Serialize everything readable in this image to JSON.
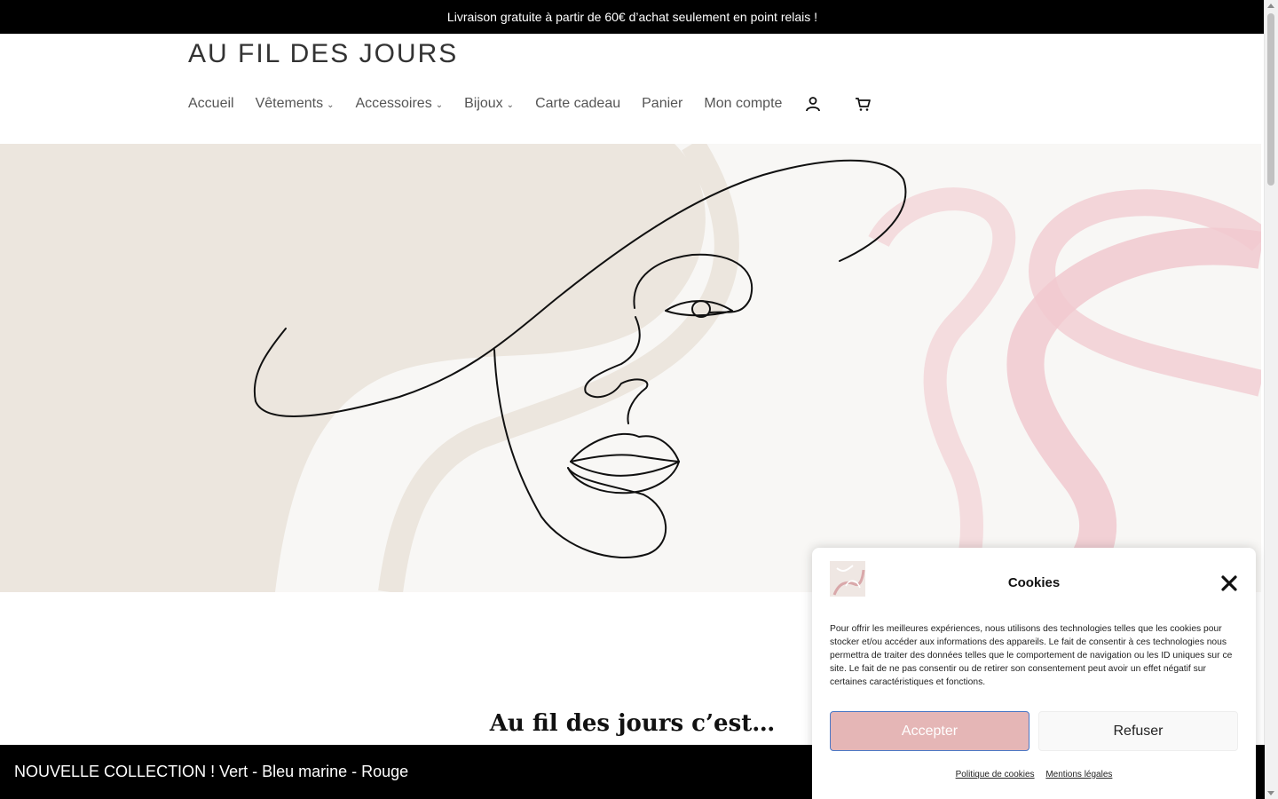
{
  "announcement": "Livraison gratuite à partir de 60€ d’achat seulement en point relais !",
  "brand": "AU FIL DES JOURS",
  "nav": {
    "items": [
      {
        "label": "Accueil",
        "dropdown": false
      },
      {
        "label": "Vêtements",
        "dropdown": true
      },
      {
        "label": "Accessoires",
        "dropdown": true
      },
      {
        "label": "Bijoux",
        "dropdown": true
      },
      {
        "label": "Carte cadeau",
        "dropdown": false
      },
      {
        "label": "Panier",
        "dropdown": false
      },
      {
        "label": "Mon compte",
        "dropdown": false
      }
    ],
    "icons": [
      "user-icon",
      "cart-icon"
    ]
  },
  "hero": {
    "image": "line-art-woman-face-with-hat",
    "colors": {
      "beige": "#ece6de",
      "pink": "#f1c9cf",
      "background": "#f8f7f5"
    }
  },
  "section_title": "Au fil des jours c’est…",
  "bottom_banner": "NOUVELLE COLLECTION ! Vert - Bleu marine - Rouge",
  "cookie": {
    "title": "Cookies",
    "text": "Pour offrir les meilleures expériences, nous utilisons des technologies telles que les cookies pour stocker et/ou accéder aux informations des appareils. Le fait de consentir à ces technologies nous permettra de traiter des données telles que le comportement de navigation ou les ID uniques sur ce site. Le fait de ne pas consentir ou de retirer son consentement peut avoir un effet négatif sur certaines caractéristiques et fonctions.",
    "accept": "Accepter",
    "refuse": "Refuser",
    "links": [
      "Politique de cookies",
      "Mentions légales"
    ],
    "colors": {
      "accept_bg": "#e5b6b6"
    }
  }
}
